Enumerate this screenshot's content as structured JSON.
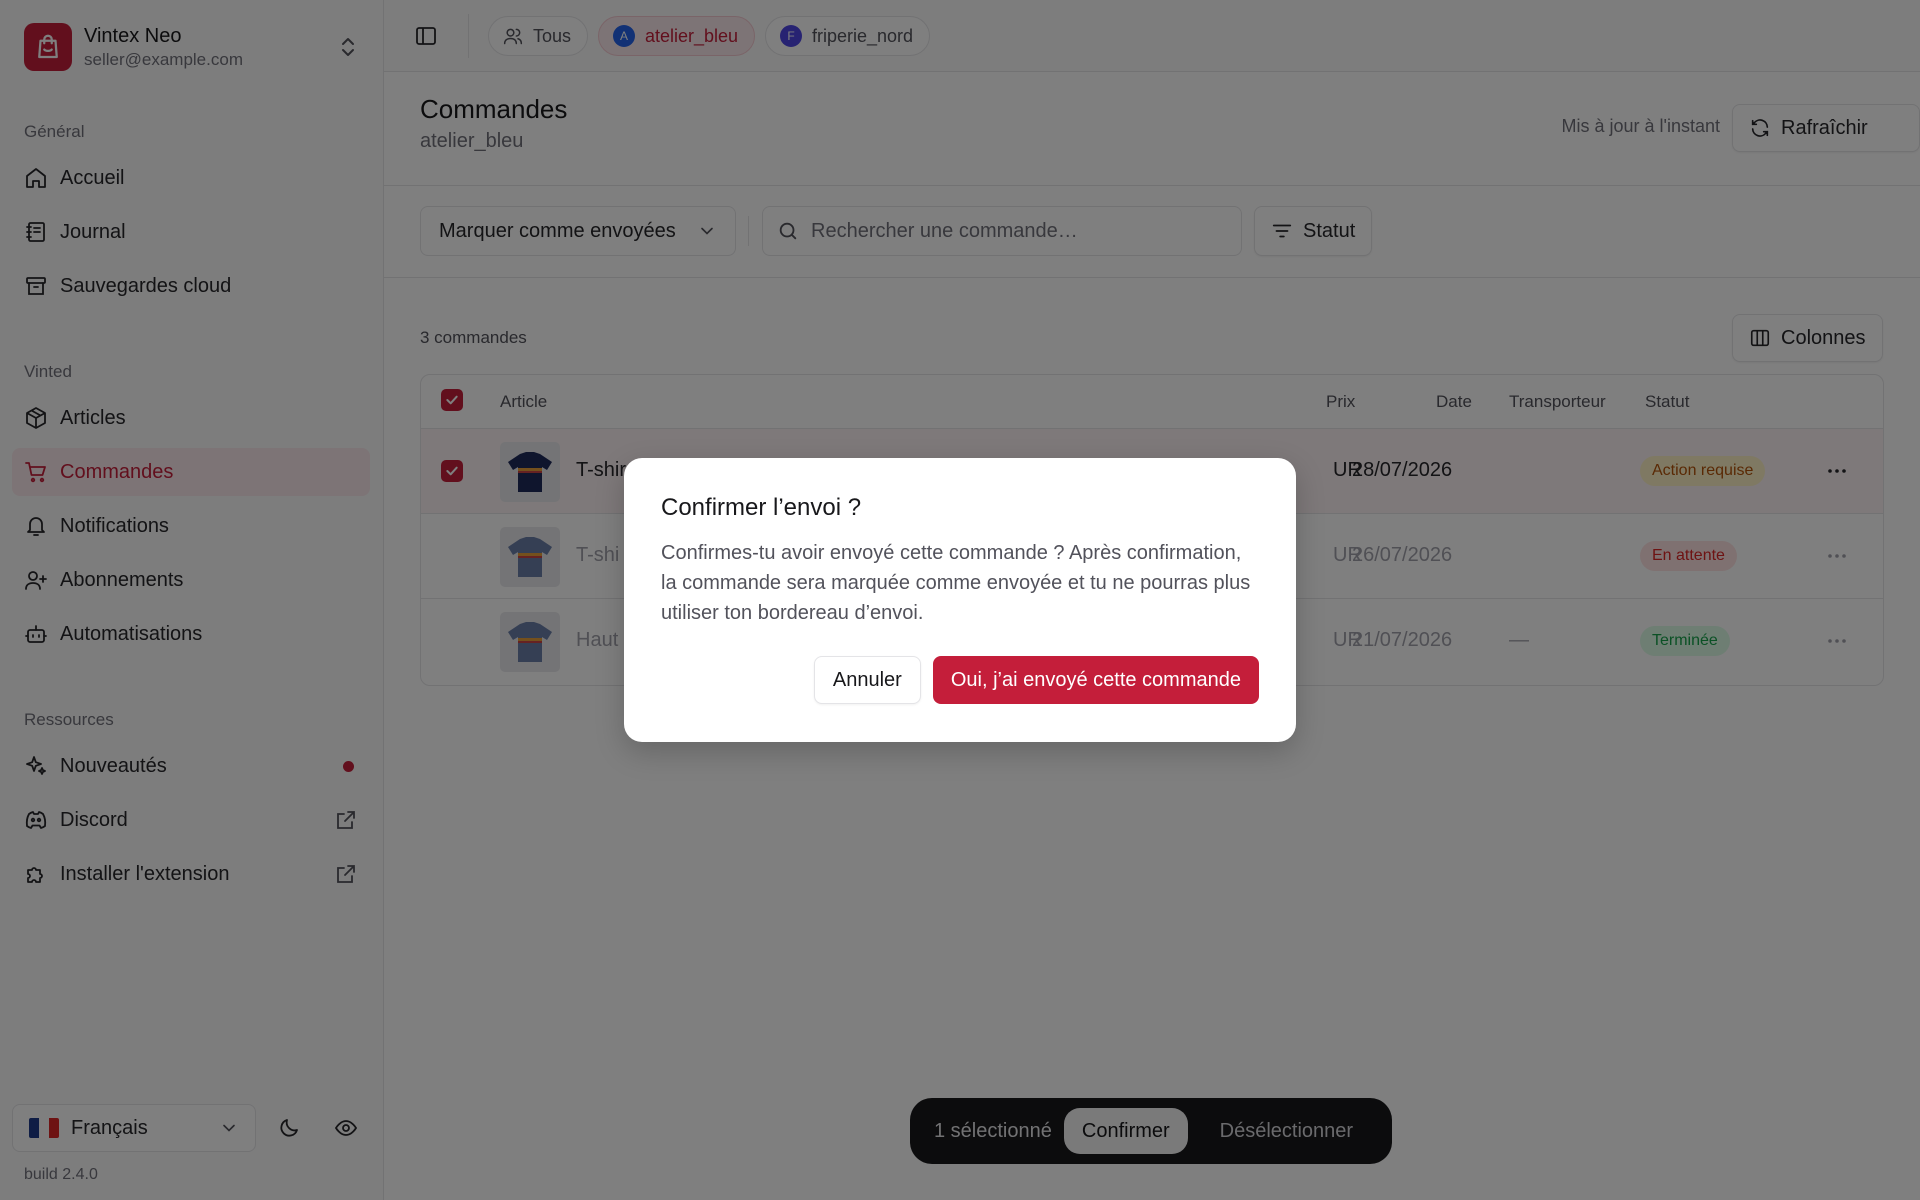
{
  "account": {
    "name": "Vintex Neo",
    "email": "seller@example.com"
  },
  "sidebar": {
    "groups": [
      {
        "label": "Général",
        "items": [
          {
            "label": "Accueil",
            "icon": "home-icon"
          },
          {
            "label": "Journal",
            "icon": "journal-icon"
          },
          {
            "label": "Sauvegardes cloud",
            "icon": "archive-icon"
          }
        ]
      },
      {
        "label": "Vinted",
        "items": [
          {
            "label": "Articles",
            "icon": "package-icon"
          },
          {
            "label": "Commandes",
            "icon": "cart-icon",
            "active": true
          },
          {
            "label": "Notifications",
            "icon": "bell-icon"
          },
          {
            "label": "Abonnements",
            "icon": "user-plus-icon"
          },
          {
            "label": "Automatisations",
            "icon": "bot-icon"
          }
        ]
      },
      {
        "label": "Ressources",
        "items": [
          {
            "label": "Nouveautés",
            "icon": "sparkles-icon"
          },
          {
            "label": "Discord",
            "icon": "discord-icon"
          },
          {
            "label": "Installer l'extension",
            "icon": "puzzle-icon"
          }
        ]
      }
    ],
    "language": "Français",
    "build": "build 2.4.0"
  },
  "topbar": {
    "filters": [
      {
        "label": "Tous",
        "icon": "users-icon"
      },
      {
        "label": "atelier_bleu",
        "avatar": "A",
        "active": true
      },
      {
        "label": "friperie_nord",
        "avatar": "F"
      }
    ]
  },
  "header": {
    "title": "Commandes",
    "subtitle": "atelier_bleu",
    "updated": "Mis à jour à l'instant",
    "refresh_label": "Rafraîchir"
  },
  "toolbar": {
    "bulk_action": "Marquer comme envoyées",
    "search_placeholder": "Rechercher une commande…",
    "status_filter": "Statut",
    "columns_label": "Colonnes"
  },
  "orders": {
    "count": "3 commandes",
    "columns": [
      "Article",
      "Prix",
      "Date",
      "Transporteur",
      "Statut"
    ],
    "rows": [
      {
        "article": "T-shir",
        "price": "UR",
        "date": "28/07/2026",
        "carrier": "",
        "status": "Action requise",
        "selected": true
      },
      {
        "article": "T-shi",
        "price": "UR",
        "date": "26/07/2026",
        "carrier": "",
        "status": "En attente",
        "selected": false
      },
      {
        "article": "Haut",
        "price": "UR",
        "date": "21/07/2026",
        "carrier": "—",
        "status": "Terminée",
        "selected": false
      }
    ]
  },
  "actionbar": {
    "selected": "1 sélectionné",
    "confirm": "Confirmer",
    "deselect": "Désélectionner"
  },
  "modal": {
    "title": "Confirmer l’envoi ?",
    "description": "Confirmes-tu avoir envoyé cette commande ? Après confirmation, la commande sera marquée comme envoyée et tu ne pourras plus utiliser ton bordereau d’envoi.",
    "cancel": "Annuler",
    "confirm": "Oui, j’ai envoyé cette commande"
  },
  "colors": {
    "accent": "#c41e3a",
    "status_action": "#b45309",
    "status_pending": "#dc2626",
    "status_done": "#16a34a"
  }
}
